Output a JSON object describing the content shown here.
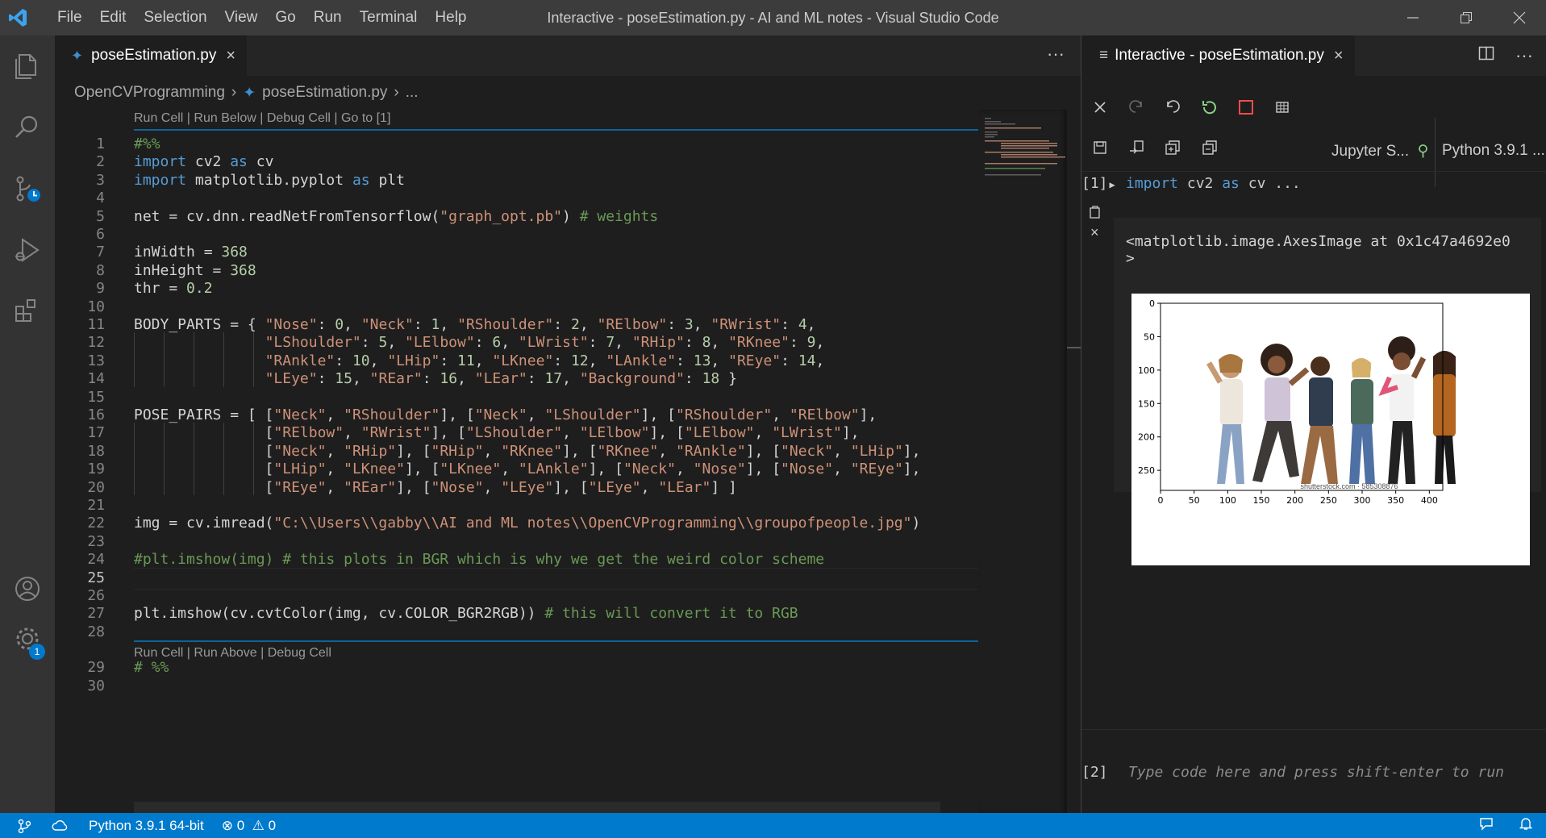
{
  "titlebar": {
    "menu": [
      "File",
      "Edit",
      "Selection",
      "View",
      "Go",
      "Run",
      "Terminal",
      "Help"
    ],
    "title": "Interactive - poseEstimation.py - AI and ML notes - Visual Studio Code"
  },
  "activity": {
    "items": [
      "explorer-icon",
      "search-icon",
      "source-control-icon",
      "run-debug-icon",
      "extensions-icon",
      "account-icon",
      "settings-gear-icon"
    ],
    "settings_badge": "1"
  },
  "editor": {
    "tab_label": "poseEstimation.py",
    "breadcrumb": {
      "folder": "OpenCVProgramming",
      "file": "poseEstimation.py",
      "tail": "..."
    },
    "codelens_top": "Run Cell | Run Below | Debug Cell | Go to [1]",
    "codelens_bottom": "Run Cell | Run Above | Debug Cell",
    "current_line": "25",
    "lines": [
      {
        "n": "1",
        "t": "#%%"
      },
      {
        "n": "2",
        "t": "import cv2 as cv"
      },
      {
        "n": "3",
        "t": "import matplotlib.pyplot as plt"
      },
      {
        "n": "4",
        "t": ""
      },
      {
        "n": "5",
        "t": "net = cv.dnn.readNetFromTensorflow(\"graph_opt.pb\") # weights"
      },
      {
        "n": "6",
        "t": ""
      },
      {
        "n": "7",
        "t": "inWidth = 368"
      },
      {
        "n": "8",
        "t": "inHeight = 368"
      },
      {
        "n": "9",
        "t": "thr = 0.2"
      },
      {
        "n": "10",
        "t": ""
      },
      {
        "n": "11",
        "t": "BODY_PARTS = { \"Nose\": 0, \"Neck\": 1, \"RShoulder\": 2, \"RElbow\": 3, \"RWrist\": 4,"
      },
      {
        "n": "12",
        "t": "               \"LShoulder\": 5, \"LElbow\": 6, \"LWrist\": 7, \"RHip\": 8, \"RKnee\": 9,"
      },
      {
        "n": "13",
        "t": "               \"RAnkle\": 10, \"LHip\": 11, \"LKnee\": 12, \"LAnkle\": 13, \"REye\": 14,"
      },
      {
        "n": "14",
        "t": "               \"LEye\": 15, \"REar\": 16, \"LEar\": 17, \"Background\": 18 }"
      },
      {
        "n": "15",
        "t": ""
      },
      {
        "n": "16",
        "t": "POSE_PAIRS = [ [\"Neck\", \"RShoulder\"], [\"Neck\", \"LShoulder\"], [\"RShoulder\", \"RElbow\"],"
      },
      {
        "n": "17",
        "t": "               [\"RElbow\", \"RWrist\"], [\"LShoulder\", \"LElbow\"], [\"LElbow\", \"LWrist\"],"
      },
      {
        "n": "18",
        "t": "               [\"Neck\", \"RHip\"], [\"RHip\", \"RKnee\"], [\"RKnee\", \"RAnkle\"], [\"Neck\", \"LHip\"],"
      },
      {
        "n": "19",
        "t": "               [\"LHip\", \"LKnee\"], [\"LKnee\", \"LAnkle\"], [\"Neck\", \"Nose\"], [\"Nose\", \"REye\"],"
      },
      {
        "n": "20",
        "t": "               [\"REye\", \"REar\"], [\"Nose\", \"LEye\"], [\"LEye\", \"LEar\"] ]"
      },
      {
        "n": "21",
        "t": ""
      },
      {
        "n": "22",
        "t": "img = cv.imread(\"C:\\\\Users\\\\gabby\\\\AI and ML notes\\\\OpenCVProgramming\\\\groupofpeople.jpg\")"
      },
      {
        "n": "23",
        "t": ""
      },
      {
        "n": "24",
        "t": "#plt.imshow(img) # this plots in BGR which is why we get the weird color scheme"
      },
      {
        "n": "25",
        "t": ""
      },
      {
        "n": "26",
        "t": ""
      },
      {
        "n": "27",
        "t": "plt.imshow(cv.cvtColor(img, cv.COLOR_BGR2RGB)) # this will convert it to RGB"
      },
      {
        "n": "28",
        "t": ""
      },
      {
        "n": "29",
        "t": "# %%"
      },
      {
        "n": "30",
        "t": ""
      }
    ]
  },
  "interactive": {
    "tab_label": "Interactive - poseEstimation.py",
    "kernel_label": "Jupyter S...",
    "python_label": "Python 3.9.1 ...",
    "cell1_label": "[1]",
    "cell1_code": "import cv2 as cv ...",
    "output_text": "<matplotlib.image.AxesImage at 0x1c47a4692e0\n>",
    "watermark": "shutterstock.com · 585308876",
    "input_label": "[2]",
    "input_placeholder": "Type code here and press shift-enter to run"
  },
  "chart_data": {
    "type": "image",
    "x_ticks": [
      "0",
      "50",
      "100",
      "150",
      "200",
      "250",
      "300",
      "350",
      "400"
    ],
    "y_ticks": [
      "0",
      "50",
      "100",
      "150",
      "200",
      "250"
    ],
    "xlim": [
      0,
      420
    ],
    "ylim": [
      0,
      280
    ]
  },
  "status": {
    "python": "Python 3.9.1 64-bit",
    "errors": "0",
    "warnings": "0"
  },
  "colors": {
    "accent": "#007acc",
    "keyword": "#569cd6",
    "string": "#ce9178",
    "number": "#b5cea8",
    "comment": "#6a9955"
  }
}
